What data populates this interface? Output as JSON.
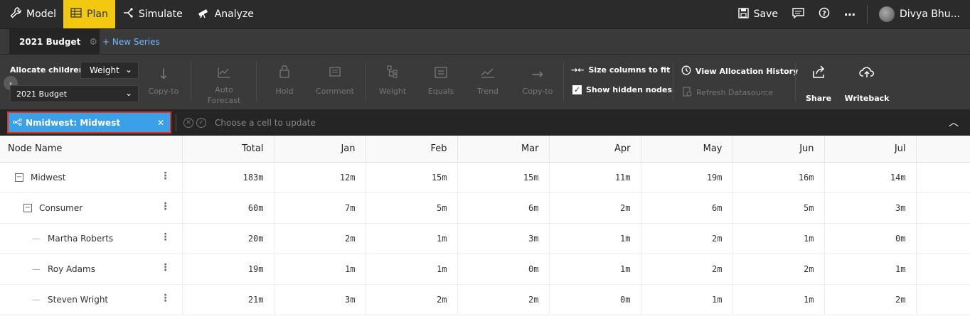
{
  "topnav": {
    "items": [
      {
        "label": "Model",
        "icon": "wrench-icon"
      },
      {
        "label": "Plan",
        "icon": "table-icon"
      },
      {
        "label": "Simulate",
        "icon": "branch-icon"
      },
      {
        "label": "Analyze",
        "icon": "telescope-icon"
      }
    ],
    "active": "Plan",
    "accent_color": "#f2c811",
    "save_label": "Save",
    "user_name": "Divya Bhu..."
  },
  "tabs": {
    "current": "2021 Budget",
    "new_series": "+ New Series"
  },
  "ribbon": {
    "allocate_label": "Allocate children",
    "method_value": "Weight",
    "budget_value": "2021 Budget",
    "buttons": {
      "copy_to_left": "Copy-to",
      "auto_forecast": "Auto Forecast",
      "hold": "Hold",
      "comment": "Comment",
      "weight": "Weight",
      "equals": "Equals",
      "trend": "Trend",
      "copy_to_right": "Copy-to",
      "share": "Share",
      "writeback": "Writeback"
    },
    "size_columns": "Size columns to fit",
    "show_hidden": "Show hidden nodes",
    "view_history": "View Allocation History",
    "refresh": "Refresh Datasource"
  },
  "filter": {
    "chip_label": "Nmidwest: Midwest",
    "hint": "Choose a cell to update",
    "chip_color": "#3aa0e8"
  },
  "grid": {
    "columns": [
      "Node Name",
      "Total",
      "Jan",
      "Feb",
      "Mar",
      "Apr",
      "May",
      "Jun",
      "Jul"
    ],
    "rows": [
      {
        "name": "Midwest",
        "values": [
          "183m",
          "12m",
          "15m",
          "15m",
          "11m",
          "19m",
          "16m",
          "14m"
        ]
      },
      {
        "name": "Consumer",
        "values": [
          "60m",
          "7m",
          "5m",
          "6m",
          "2m",
          "6m",
          "5m",
          "3m"
        ]
      },
      {
        "name": "Martha Roberts",
        "values": [
          "20m",
          "2m",
          "1m",
          "3m",
          "1m",
          "2m",
          "1m",
          "0m"
        ]
      },
      {
        "name": "Roy Adams",
        "values": [
          "19m",
          "1m",
          "1m",
          "0m",
          "1m",
          "2m",
          "2m",
          "1m"
        ]
      },
      {
        "name": "Steven Wright",
        "values": [
          "21m",
          "3m",
          "2m",
          "2m",
          "0m",
          "1m",
          "1m",
          "2m"
        ]
      }
    ]
  }
}
